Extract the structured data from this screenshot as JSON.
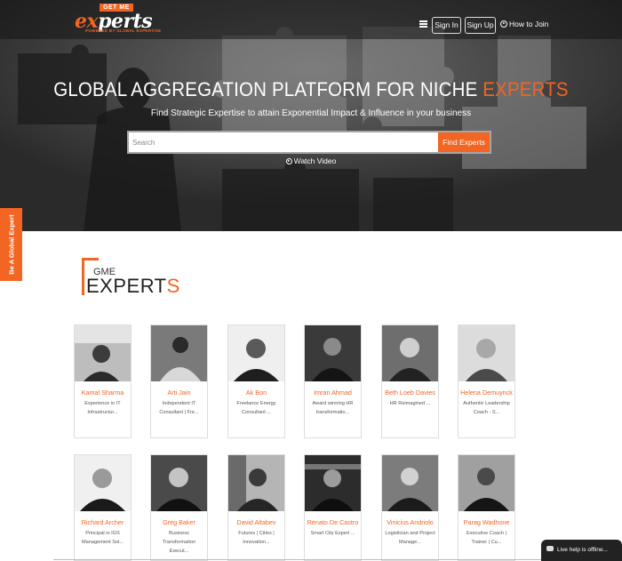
{
  "logo": {
    "badge": "GET ME",
    "word_x": "ex",
    "word_rest": "perts",
    "tagline": "POWERED BY GLOBAL EXPERTISE"
  },
  "header": {
    "menu_icon": "hamburger-menu-icon",
    "sign_in": "Sign In",
    "sign_up": "Sign Up",
    "how_to_join": "How to Join"
  },
  "hero": {
    "headline_main": "GLOBAL AGGREGATION PLATFORM FOR NICHE ",
    "headline_accent": "EXPERTS",
    "subtitle": "Find Strategic Expertise to attain Exponential Impact & Influence in your business",
    "search_placeholder": "Search",
    "search_button": "Find Experts",
    "watch_video": "Watch Video"
  },
  "side_tab": "Be A Global Expert",
  "section": {
    "gme": "GME",
    "title_main": "EXPERT",
    "title_accent": "S"
  },
  "experts": [
    {
      "name": "Kamal Sharma",
      "desc": "Experience in IT Infrastructur..."
    },
    {
      "name": "Arti Jain",
      "desc": "Independent IT Consultant | Fre..."
    },
    {
      "name": "Ak Bon",
      "desc": "Freelance Energy Consultant ..."
    },
    {
      "name": "Imran Ahmad",
      "desc": "Award winning HR transformatio..."
    },
    {
      "name": "Beth Loeb Davies",
      "desc": "HR Reimagined ..."
    },
    {
      "name": "Helena Demuynck",
      "desc": "Authentic Leadership Coach - S..."
    },
    {
      "name": "Richard Archer",
      "desc": "Principal in IGS Management Sol..."
    },
    {
      "name": "Greg Baker",
      "desc": "Business Transformation Execut..."
    },
    {
      "name": "David Altabev",
      "desc": "Futures | Cities | Innovation..."
    },
    {
      "name": "Renato De Castro",
      "desc": "Smart City Expert ..."
    },
    {
      "name": "Vinicius Andriolo",
      "desc": "Logistician and Project Manage..."
    },
    {
      "name": "Parag Wadhone",
      "desc": "Executive Coach | Trainer | Cu..."
    }
  ],
  "chat": {
    "label": "Live help is offline..."
  },
  "colors": {
    "accent": "#f26522",
    "dark": "#2b2b2b"
  }
}
